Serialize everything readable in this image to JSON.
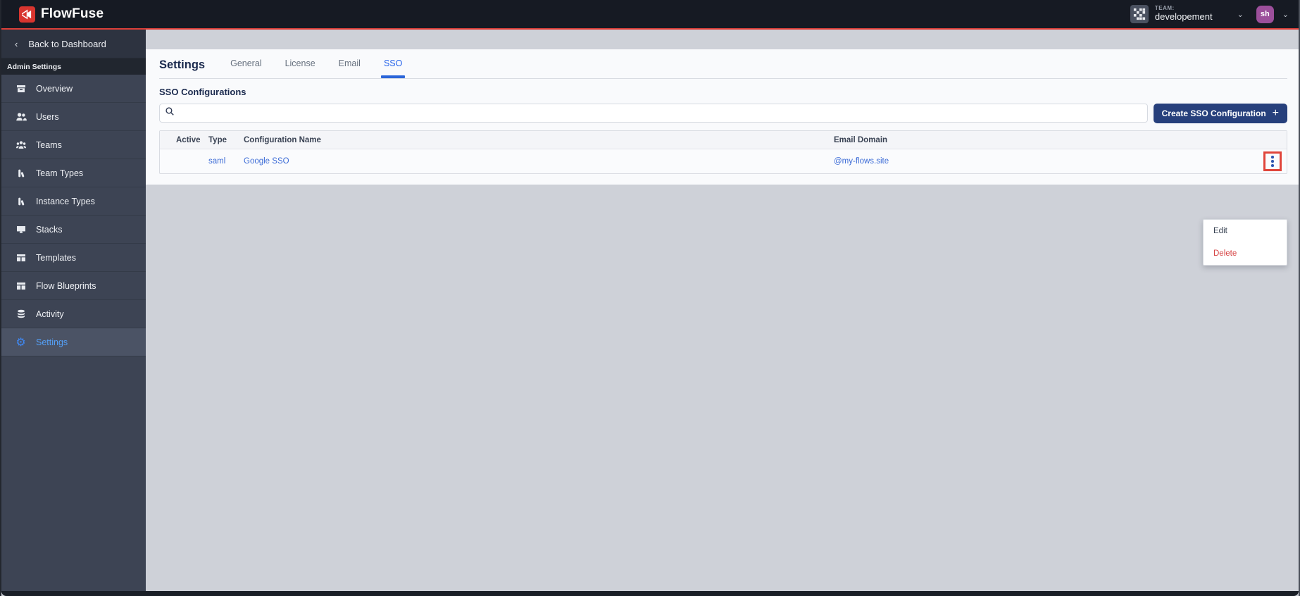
{
  "header": {
    "brand": "FlowFuse",
    "team_kicker": "TEAM:",
    "team_name": "developement",
    "user_initials": "sh"
  },
  "sidebar": {
    "back_label": "Back to Dashboard",
    "back_chevron": "‹",
    "section_label": "Admin Settings",
    "items": [
      {
        "label": "Overview"
      },
      {
        "label": "Users"
      },
      {
        "label": "Teams"
      },
      {
        "label": "Team Types"
      },
      {
        "label": "Instance Types"
      },
      {
        "label": "Stacks"
      },
      {
        "label": "Templates"
      },
      {
        "label": "Flow Blueprints"
      },
      {
        "label": "Activity"
      },
      {
        "label": "Settings"
      }
    ]
  },
  "main": {
    "page_title": "Settings",
    "tabs": [
      {
        "label": "General"
      },
      {
        "label": "License"
      },
      {
        "label": "Email"
      },
      {
        "label": "SSO"
      }
    ],
    "section_title": "SSO Configurations",
    "create_button_label": "Create SSO Configuration",
    "create_button_plus": "+",
    "table": {
      "columns": [
        "Active",
        "Type",
        "Configuration Name",
        "Email Domain"
      ],
      "rows": [
        {
          "active": "",
          "type": "saml",
          "name": "Google SSO",
          "email_domain": "@my-flows.site"
        }
      ]
    },
    "context_menu": {
      "edit_label": "Edit",
      "delete_label": "Delete"
    }
  },
  "colors": {
    "accent_red": "#dd3f39",
    "annotation_red": "#e0453b",
    "brand_red": "#d8352f",
    "primary_navy": "#27407c",
    "tab_active_blue": "#2563eb",
    "link_blue": "#3b6bd6",
    "sidebar_bg": "#3d4454",
    "header_bg": "#161a23",
    "danger_red": "#d64545"
  }
}
